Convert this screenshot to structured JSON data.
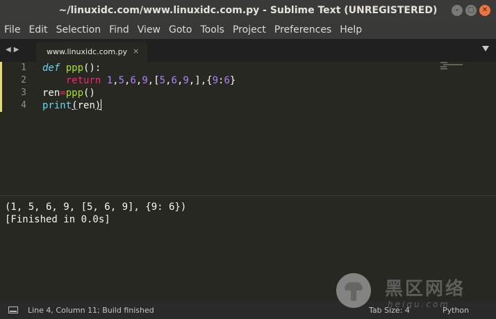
{
  "window": {
    "title": "~/linuxidc.com/www.linuxidc.com.py - Sublime Text (UNREGISTERED)"
  },
  "menu": [
    "File",
    "Edit",
    "Selection",
    "Find",
    "View",
    "Goto",
    "Tools",
    "Project",
    "Preferences",
    "Help"
  ],
  "tabs": [
    {
      "label": "www.linuxidc.com.py",
      "close": "×"
    }
  ],
  "editor": {
    "line_numbers": [
      "1",
      "2",
      "3",
      "4"
    ],
    "code": {
      "l1": {
        "kw": "def",
        "name": "ppp",
        "rest": "():"
      },
      "l2": {
        "indent": "    ",
        "kw": "return",
        "sp": " ",
        "n1": "1",
        "c1": ",",
        "n2": "5",
        "c2": ",",
        "n3": "6",
        "c3": ",",
        "n4": "9",
        "c4": ",[",
        "n5": "5",
        "c5": ",",
        "n6": "6",
        "c6": ",",
        "n7": "9",
        "c7": ",],{",
        "n8": "9",
        "c8": ":",
        "n9": "6",
        "c9": "}"
      },
      "l3": {
        "var": "ren",
        "op": "=",
        "call": "ppp",
        "rest": "()"
      },
      "l4": {
        "fn": "print",
        "open": "(",
        "arg": "ren",
        "close": ")"
      }
    }
  },
  "output": {
    "lines": [
      "(1, 5, 6, 9, [5, 6, 9], {9: 6})",
      "[Finished in 0.0s]"
    ]
  },
  "status": {
    "position": "Line 4, Column 11; Build finished",
    "tab_size": "Tab Size: 4",
    "syntax": "Python"
  },
  "watermark": {
    "text": "黑区网络",
    "sub": "heiqu.com"
  },
  "colors": {
    "background": "#272822",
    "keyword": "#f92672",
    "function": "#a6e22e",
    "number": "#ae81ff",
    "builtin": "#66d9ef"
  },
  "icons": {
    "window_close": "close-icon",
    "window_maximize": "maximize-icon",
    "window_minimize": "minimize-icon"
  }
}
